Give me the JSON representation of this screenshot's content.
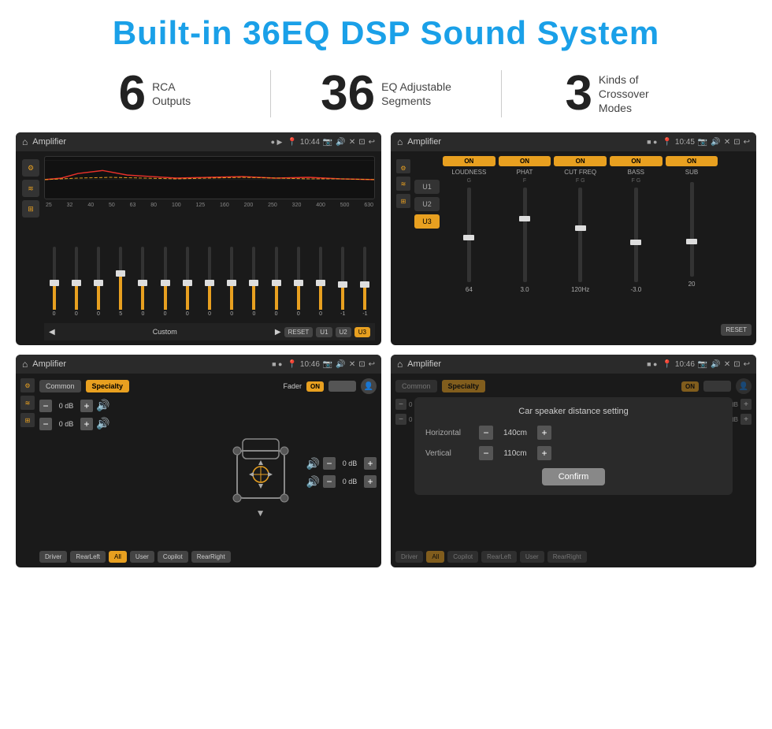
{
  "header": {
    "title": "Built-in 36EQ DSP Sound System"
  },
  "stats": [
    {
      "number": "6",
      "label": "RCA\nOutputs"
    },
    {
      "number": "36",
      "label": "EQ Adjustable\nSegments"
    },
    {
      "number": "3",
      "label": "Kinds of\nCrossover Modes"
    }
  ],
  "screens": {
    "eq": {
      "title": "Amplifier",
      "time": "10:44",
      "freq_labels": [
        "25",
        "32",
        "40",
        "50",
        "63",
        "80",
        "100",
        "125",
        "160",
        "200",
        "250",
        "320",
        "400",
        "500",
        "630"
      ],
      "slider_values": [
        "0",
        "0",
        "0",
        "5",
        "0",
        "0",
        "0",
        "0",
        "0",
        "0",
        "0",
        "0",
        "0",
        "-1",
        "-1"
      ],
      "preset": "Custom",
      "buttons": [
        "RESET",
        "U1",
        "U2",
        "U3"
      ]
    },
    "crossover": {
      "title": "Amplifier",
      "time": "10:45",
      "presets": [
        "U1",
        "U2",
        "U3"
      ],
      "active_preset": "U3",
      "channels": [
        "LOUDNESS",
        "PHAT",
        "CUT FREQ",
        "BASS",
        "SUB"
      ],
      "reset_label": "RESET"
    },
    "fader": {
      "title": "Amplifier",
      "time": "10:46",
      "tabs": [
        "Common",
        "Specialty"
      ],
      "active_tab": "Specialty",
      "fader_label": "Fader",
      "on_label": "ON",
      "controls": [
        {
          "value": "0 dB"
        },
        {
          "value": "0 dB"
        },
        {
          "value": "0 dB"
        },
        {
          "value": "0 dB"
        }
      ],
      "bottom_btns": [
        "Driver",
        "RearLeft",
        "All",
        "User",
        "Copilot",
        "RearRight"
      ]
    },
    "dialog": {
      "title": "Amplifier",
      "time": "10:46",
      "dialog_title": "Car speaker distance setting",
      "horizontal_label": "Horizontal",
      "horizontal_value": "140cm",
      "vertical_label": "Vertical",
      "vertical_value": "110cm",
      "confirm_label": "Confirm",
      "tabs": [
        "Common",
        "Specialty"
      ],
      "active_tab": "Specialty",
      "on_label": "ON",
      "bottom_btns": [
        "Driver",
        "RearLeft",
        "All",
        "User",
        "Copilot",
        "RearRight"
      ]
    }
  }
}
